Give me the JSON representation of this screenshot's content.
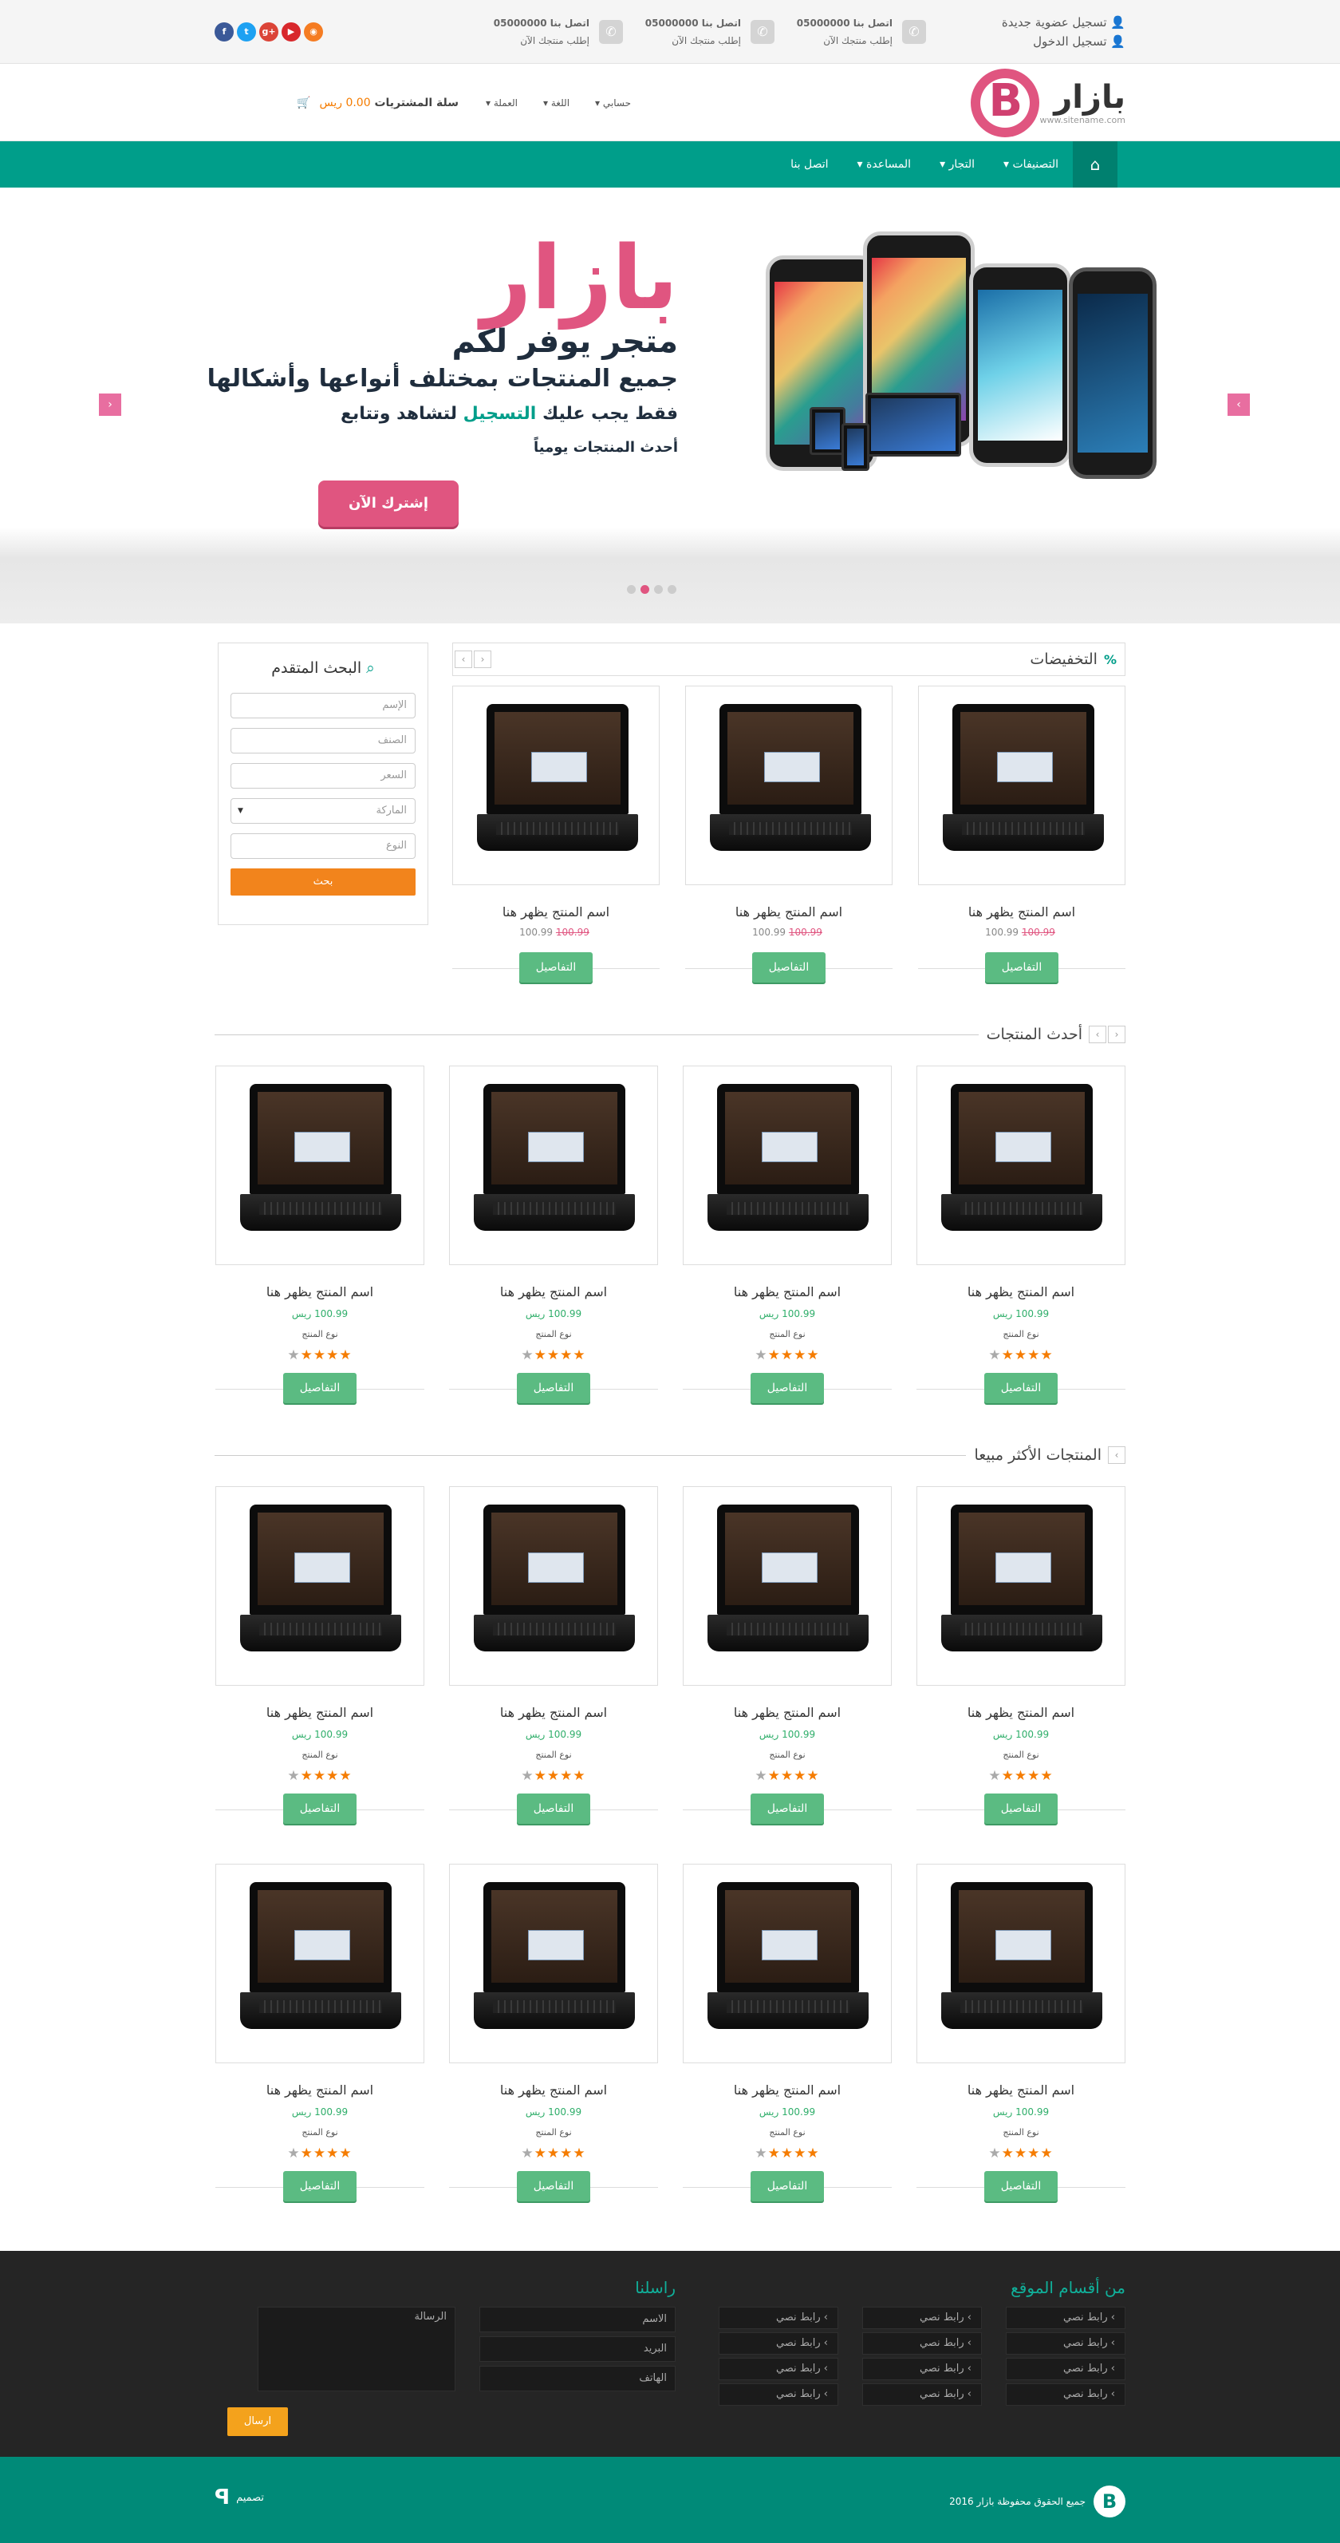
{
  "topbar": {
    "register": "تسجيل عضوية جديدة",
    "login": "تسجيل الدخول",
    "contacts": [
      {
        "title": "اتصل بنا 05000000",
        "sub": "إطلب منتجك الآن"
      },
      {
        "title": "اتصل بنا 05000000",
        "sub": "إطلب منتجك الآن"
      },
      {
        "title": "اتصل بنا 05000000",
        "sub": "إطلب منتجك الآن"
      }
    ],
    "socials": [
      {
        "icon": "rss-icon",
        "glyph": "◉",
        "color": "#f57c22"
      },
      {
        "icon": "youtube-icon",
        "glyph": "▶",
        "color": "#d8282c"
      },
      {
        "icon": "googleplus-icon",
        "glyph": "g+",
        "color": "#db4437"
      },
      {
        "icon": "twitter-icon",
        "glyph": "t",
        "color": "#1da1f2"
      },
      {
        "icon": "facebook-icon",
        "glyph": "f",
        "color": "#3b5998"
      }
    ]
  },
  "header": {
    "logo_name": "بازار",
    "logo_site": "www.sitename.com",
    "account": "حسابي",
    "language": "اللغة",
    "currency": "العملة",
    "cart_label": "سلة المشتريات",
    "cart_amount": "0.00 ريس"
  },
  "nav": {
    "items": [
      "التصنيفات",
      "التجار",
      "المساعدة",
      "اتصل بنا"
    ]
  },
  "slider": {
    "title": "بازار",
    "line1": "متجر يوفر لكم",
    "line2": "جميع المنتجات بمختلف أنواعها وأشكالها",
    "line3_a": "فقط يجب عليك",
    "line3_highlight": "التسجيل",
    "line3_b": "لتشاهد وتتابع",
    "line4": "أحدث المنتجات يومياً",
    "cta": "إشترك الآن"
  },
  "deals": {
    "title": "التخفيضات",
    "products": [
      {
        "name": "اسم المنتج يظهر هنا",
        "price": "100.99",
        "old_price": "100.99",
        "button": "التفاصيل"
      },
      {
        "name": "اسم المنتج يظهر هنا",
        "price": "100.99",
        "old_price": "100.99",
        "button": "التفاصيل"
      },
      {
        "name": "اسم المنتج يظهر هنا",
        "price": "100.99",
        "old_price": "100.99",
        "button": "التفاصيل"
      }
    ]
  },
  "search": {
    "title": "البحث المتقدم",
    "name_placeholder": "الإسم",
    "category_placeholder": "الصنف",
    "price_placeholder": "السعر",
    "brand_select": "الماركة",
    "type_placeholder": "النوع",
    "button": "بحث"
  },
  "latest": {
    "title": "أحدث المنتجات",
    "products": [
      {
        "name": "اسم المنتج يظهر هنا",
        "price": "100.99 ريس",
        "type": "نوع المنتج",
        "rating": 4,
        "button": "التفاصيل"
      },
      {
        "name": "اسم المنتج يظهر هنا",
        "price": "100.99 ريس",
        "type": "نوع المنتج",
        "rating": 4,
        "button": "التفاصيل"
      },
      {
        "name": "اسم المنتج يظهر هنا",
        "price": "100.99 ريس",
        "type": "نوع المنتج",
        "rating": 4,
        "button": "التفاصيل"
      },
      {
        "name": "اسم المنتج يظهر هنا",
        "price": "100.99 ريس",
        "type": "نوع المنتج",
        "rating": 4,
        "button": "التفاصيل"
      }
    ]
  },
  "bestsellers": {
    "title": "المنتجات الأكثر مبيعا",
    "row1": [
      {
        "name": "اسم المنتج يظهر هنا",
        "price": "100.99 ريس",
        "type": "نوع المنتج",
        "rating": 4,
        "button": "التفاصيل"
      },
      {
        "name": "اسم المنتج يظهر هنا",
        "price": "100.99 ريس",
        "type": "نوع المنتج",
        "rating": 4,
        "button": "التفاصيل"
      },
      {
        "name": "اسم المنتج يظهر هنا",
        "price": "100.99 ريس",
        "type": "نوع المنتج",
        "rating": 4,
        "button": "التفاصيل"
      },
      {
        "name": "اسم المنتج يظهر هنا",
        "price": "100.99 ريس",
        "type": "نوع المنتج",
        "rating": 4,
        "button": "التفاصيل"
      }
    ],
    "row2": [
      {
        "name": "اسم المنتج يظهر هنا",
        "price": "100.99 ريس",
        "type": "نوع المنتج",
        "rating": 4,
        "button": "التفاصيل"
      },
      {
        "name": "اسم المنتج يظهر هنا",
        "price": "100.99 ريس",
        "type": "نوع المنتج",
        "rating": 4,
        "button": "التفاصيل"
      },
      {
        "name": "اسم المنتج يظهر هنا",
        "price": "100.99 ريس",
        "type": "نوع المنتج",
        "rating": 4,
        "button": "التفاصيل"
      },
      {
        "name": "اسم المنتج يظهر هنا",
        "price": "100.99 ريس",
        "type": "نوع المنتج",
        "rating": 4,
        "button": "التفاصيل"
      }
    ]
  },
  "footer": {
    "links_title": "من أقسام الموقع",
    "link_label": "› رابط نصي",
    "contact_title": "راسلنا",
    "name_field": "الاسم",
    "email_field": "البريد",
    "phone_field": "الهاتف",
    "message_field": "الرسالة",
    "send": "ارسال",
    "copyright": "جميع الحقوق محفوظة بازار 2016",
    "design": "تصميم"
  },
  "colors": {
    "brand_pink": "#e05580",
    "teal": "#009e8a",
    "orange": "#f57c00",
    "green_button": "#5bbb82"
  }
}
